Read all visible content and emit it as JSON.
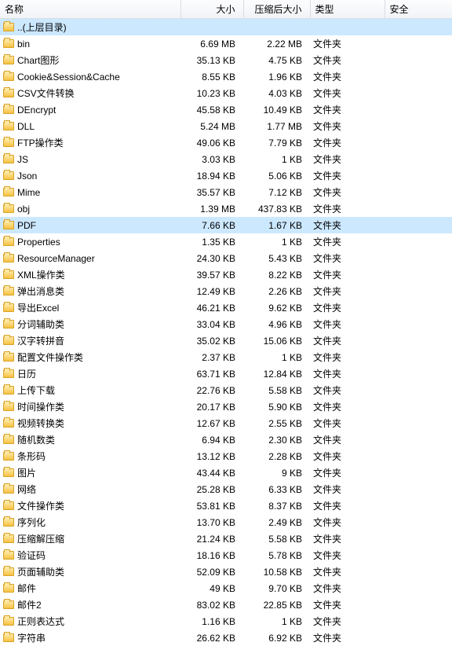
{
  "columns": {
    "name": "名称",
    "size": "大小",
    "packed": "压缩后大小",
    "type": "类型",
    "security": "安全"
  },
  "parent": {
    "label": "..(上层目录)"
  },
  "type_label": "文件夹",
  "rows": [
    {
      "name": "bin",
      "size": "6.69 MB",
      "packed": "2.22 MB"
    },
    {
      "name": "Chart图形",
      "size": "35.13 KB",
      "packed": "4.75 KB"
    },
    {
      "name": "Cookie&Session&Cache",
      "size": "8.55 KB",
      "packed": "1.96 KB"
    },
    {
      "name": "CSV文件转换",
      "size": "10.23 KB",
      "packed": "4.03 KB"
    },
    {
      "name": "DEncrypt",
      "size": "45.58 KB",
      "packed": "10.49 KB"
    },
    {
      "name": "DLL",
      "size": "5.24 MB",
      "packed": "1.77 MB"
    },
    {
      "name": "FTP操作类",
      "size": "49.06 KB",
      "packed": "7.79 KB"
    },
    {
      "name": "JS",
      "size": "3.03 KB",
      "packed": "1 KB"
    },
    {
      "name": "Json",
      "size": "18.94 KB",
      "packed": "5.06 KB"
    },
    {
      "name": "Mime",
      "size": "35.57 KB",
      "packed": "7.12 KB"
    },
    {
      "name": "obj",
      "size": "1.39 MB",
      "packed": "437.83 KB"
    },
    {
      "name": "PDF",
      "size": "7.66 KB",
      "packed": "1.67 KB",
      "selected": true
    },
    {
      "name": "Properties",
      "size": "1.35 KB",
      "packed": "1 KB"
    },
    {
      "name": "ResourceManager",
      "size": "24.30 KB",
      "packed": "5.43 KB"
    },
    {
      "name": "XML操作类",
      "size": "39.57 KB",
      "packed": "8.22 KB"
    },
    {
      "name": "弹出消息类",
      "size": "12.49 KB",
      "packed": "2.26 KB"
    },
    {
      "name": "导出Excel",
      "size": "46.21 KB",
      "packed": "9.62 KB"
    },
    {
      "name": "分词辅助类",
      "size": "33.04 KB",
      "packed": "4.96 KB"
    },
    {
      "name": "汉字转拼音",
      "size": "35.02 KB",
      "packed": "15.06 KB"
    },
    {
      "name": "配置文件操作类",
      "size": "2.37 KB",
      "packed": "1 KB"
    },
    {
      "name": "日历",
      "size": "63.71 KB",
      "packed": "12.84 KB"
    },
    {
      "name": "上传下载",
      "size": "22.76 KB",
      "packed": "5.58 KB"
    },
    {
      "name": "时间操作类",
      "size": "20.17 KB",
      "packed": "5.90 KB"
    },
    {
      "name": "视频转换类",
      "size": "12.67 KB",
      "packed": "2.55 KB"
    },
    {
      "name": "随机数类",
      "size": "6.94 KB",
      "packed": "2.30 KB"
    },
    {
      "name": "条形码",
      "size": "13.12 KB",
      "packed": "2.28 KB"
    },
    {
      "name": "图片",
      "size": "43.44 KB",
      "packed": "9 KB"
    },
    {
      "name": "网络",
      "size": "25.28 KB",
      "packed": "6.33 KB"
    },
    {
      "name": "文件操作类",
      "size": "53.81 KB",
      "packed": "8.37 KB"
    },
    {
      "name": "序列化",
      "size": "13.70 KB",
      "packed": "2.49 KB"
    },
    {
      "name": "压缩解压缩",
      "size": "21.24 KB",
      "packed": "5.58 KB"
    },
    {
      "name": "验证码",
      "size": "18.16 KB",
      "packed": "5.78 KB"
    },
    {
      "name": "页面辅助类",
      "size": "52.09 KB",
      "packed": "10.58 KB"
    },
    {
      "name": "邮件",
      "size": "49 KB",
      "packed": "9.70 KB"
    },
    {
      "name": "邮件2",
      "size": "83.02 KB",
      "packed": "22.85 KB"
    },
    {
      "name": "正则表达式",
      "size": "1.16 KB",
      "packed": "1 KB"
    },
    {
      "name": "字符串",
      "size": "26.62 KB",
      "packed": "6.92 KB"
    }
  ]
}
